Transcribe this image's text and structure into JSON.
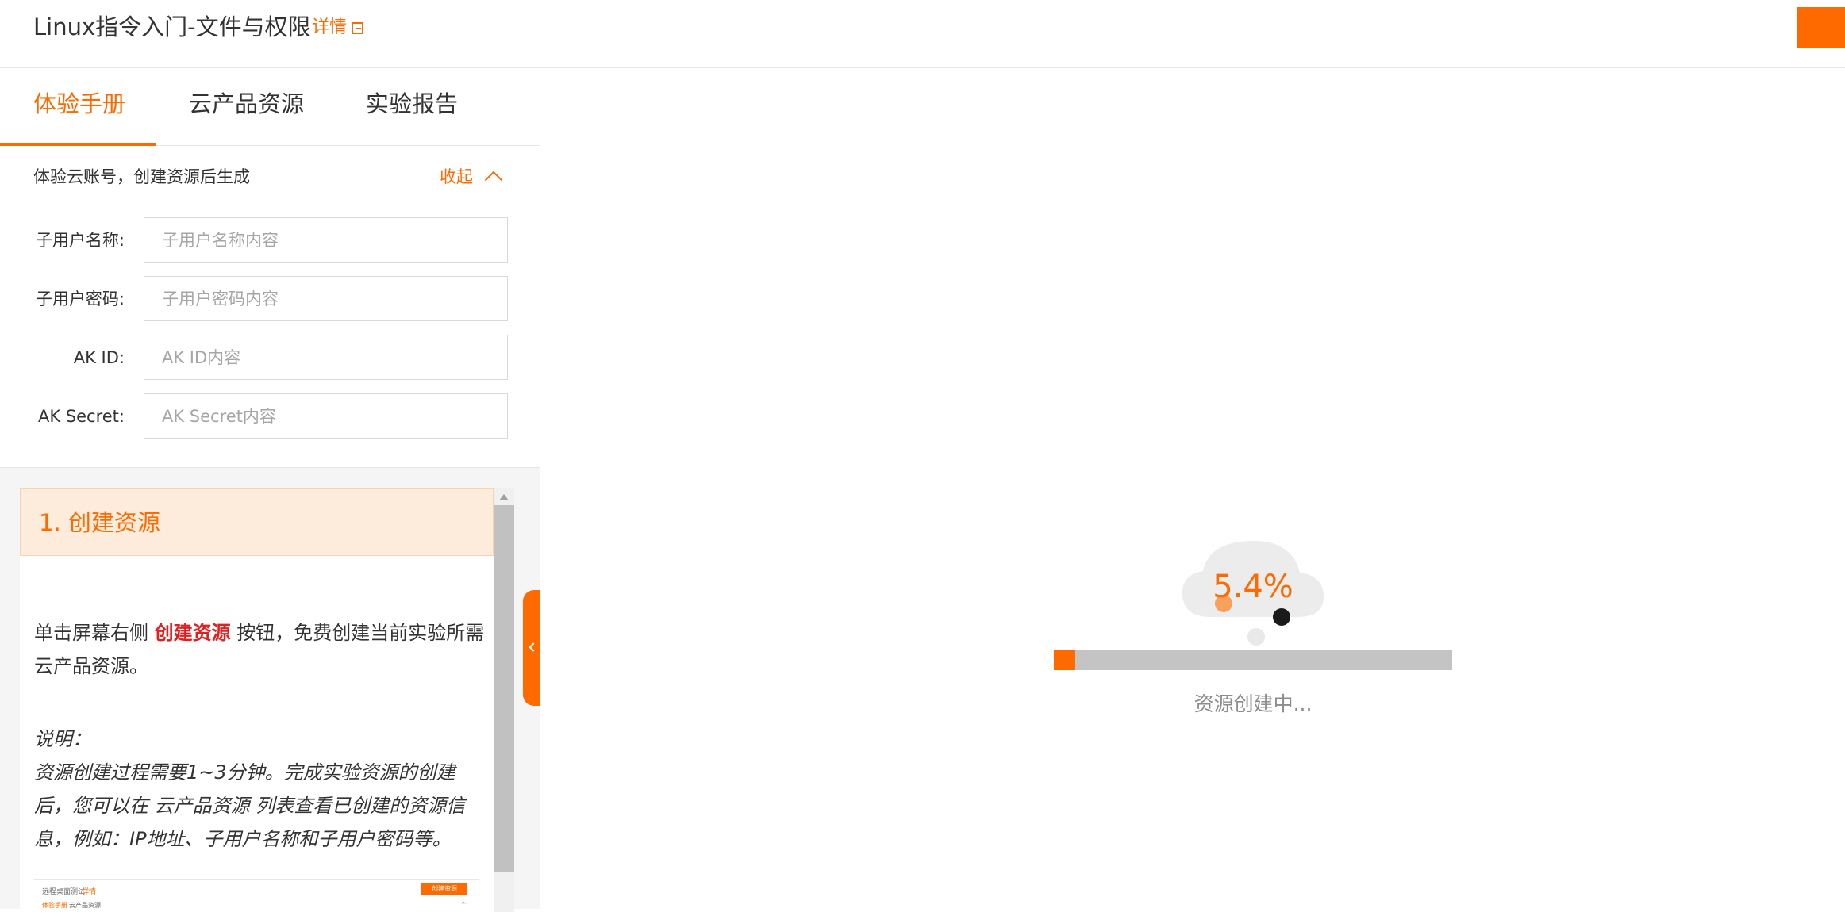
{
  "header": {
    "title": "Linux指令入门-文件与权限",
    "detail_link": "详情"
  },
  "tabs": [
    {
      "label": "体验手册",
      "active": true
    },
    {
      "label": "云产品资源",
      "active": false
    },
    {
      "label": "实验报告",
      "active": false
    }
  ],
  "account": {
    "note": "体验云账号，创建资源后生成",
    "collapse_label": "收起",
    "fields": [
      {
        "label": "子用户名称:",
        "value": "",
        "placeholder": "子用户名称内容"
      },
      {
        "label": "子用户密码:",
        "value": "",
        "placeholder": "子用户密码内容"
      },
      {
        "label": "AK ID:",
        "value": "",
        "placeholder": "AK ID内容"
      },
      {
        "label": "AK Secret:",
        "value": "",
        "placeholder": "AK Secret内容"
      }
    ]
  },
  "manual": {
    "step_title": "1. 创建资源",
    "para1_before": "单击屏幕右侧 ",
    "para1_highlight": "创建资源",
    "para1_after": " 按钮，免费创建当前实验所需云产品资源。",
    "note_title": "说明：",
    "note_body": "资源创建过程需要1~3分钟。完成实验资源的创建后，您可以在 云产品资源 列表查看已创建的资源信息，例如：IP地址、子用户名称和子用户密码等。",
    "thumbnail": {
      "title": "远程桌面测试",
      "link": "详情",
      "button": "创建资源",
      "tab1": "体验手册",
      "tab2": "云产品资源",
      "mark": "^"
    }
  },
  "loading": {
    "percent_text": "5.4%",
    "progress": 0.054,
    "status": "资源创建中..."
  },
  "colors": {
    "accent": "#ff6a00",
    "highlight_red": "#e02020",
    "track_gray": "#c4c4c4"
  }
}
